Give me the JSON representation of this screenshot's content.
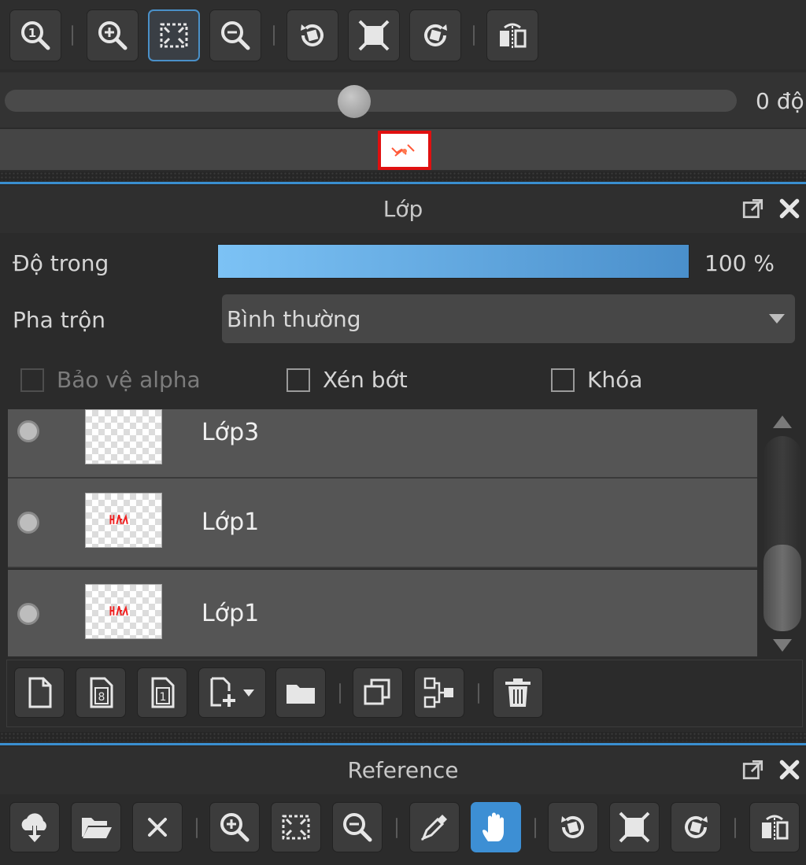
{
  "toolbar": {
    "buttons": [
      {
        "name": "actual-size-button",
        "icon": "zoom-actual-icon"
      },
      {
        "name": "zoom-in-button",
        "icon": "zoom-in-icon"
      },
      {
        "name": "fit-window-button",
        "icon": "fit-screen-icon",
        "active": true
      },
      {
        "name": "zoom-out-button",
        "icon": "zoom-out-icon"
      },
      {
        "name": "rotate-left-button",
        "icon": "rotate-left-icon"
      },
      {
        "name": "reset-view-button",
        "icon": "reset-view-icon"
      },
      {
        "name": "rotate-right-button",
        "icon": "rotate-right-icon"
      },
      {
        "name": "flip-button",
        "icon": "flip-horizontal-icon"
      }
    ]
  },
  "rotation": {
    "value_label": "0 độ",
    "slider_fraction": 0.5
  },
  "layers_panel": {
    "title": "Lớp",
    "opacity_label": "Độ trong",
    "opacity_value": "100 %",
    "opacity_fraction": 1.0,
    "blend_label": "Pha trộn",
    "blend_value": "Bình thường",
    "protect_alpha_label": "Bảo vệ alpha",
    "clip_label": "Xén bớt",
    "lock_label": "Khóa",
    "layers": [
      {
        "name": "Lớp3",
        "has_content": false
      },
      {
        "name": "Lớp1",
        "has_content": true
      },
      {
        "name": "Lớp1",
        "has_content": true
      }
    ],
    "bottom_buttons": [
      {
        "name": "new-layer-button",
        "icon": "new-page-icon"
      },
      {
        "name": "new-8bit-layer-button",
        "icon": "layer-8bit-icon"
      },
      {
        "name": "new-1bit-layer-button",
        "icon": "layer-1bit-icon"
      },
      {
        "name": "add-layer-menu-button",
        "icon": "add-layer-dropdown-icon"
      },
      {
        "name": "new-folder-button",
        "icon": "folder-icon"
      },
      {
        "name": "duplicate-layer-button",
        "icon": "duplicate-icon"
      },
      {
        "name": "merge-layer-button",
        "icon": "merge-icon"
      },
      {
        "name": "delete-layer-button",
        "icon": "trash-icon"
      }
    ]
  },
  "reference_panel": {
    "title": "Reference",
    "buttons": [
      {
        "name": "load-reference-button",
        "icon": "cloud-download-icon"
      },
      {
        "name": "open-reference-button",
        "icon": "folder-open-icon"
      },
      {
        "name": "close-reference-button",
        "icon": "close-icon"
      },
      {
        "name": "ref-zoom-in-button",
        "icon": "zoom-in-icon"
      },
      {
        "name": "ref-fit-button",
        "icon": "fit-screen-icon"
      },
      {
        "name": "ref-zoom-out-button",
        "icon": "zoom-out-icon"
      },
      {
        "name": "ref-eyedropper-button",
        "icon": "eyedropper-icon"
      },
      {
        "name": "ref-hand-button",
        "icon": "hand-icon",
        "active": true
      },
      {
        "name": "ref-rotate-left-button",
        "icon": "rotate-left-icon"
      },
      {
        "name": "ref-reset-view-button",
        "icon": "reset-view-icon"
      },
      {
        "name": "ref-rotate-right-button",
        "icon": "rotate-right-icon"
      },
      {
        "name": "ref-flip-button",
        "icon": "flip-horizontal-icon"
      }
    ]
  },
  "colors": {
    "accent": "#4a90c8",
    "opacity_bar_start": "#7cc2f5",
    "opacity_bar_end": "#4a8fcb",
    "navigator_border": "#e01010"
  }
}
